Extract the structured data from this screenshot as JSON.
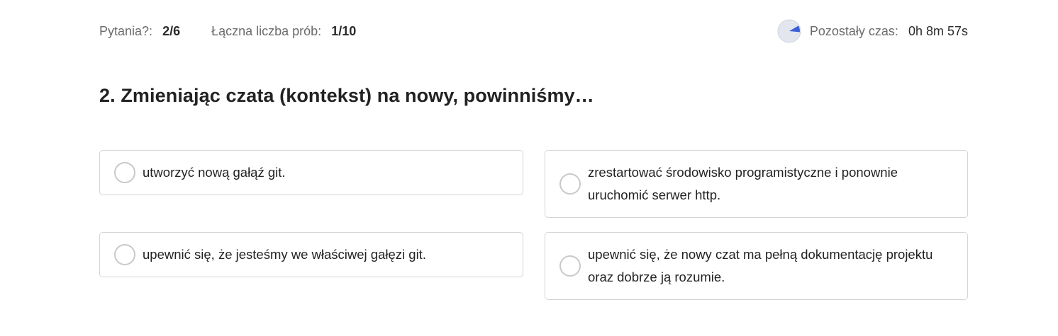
{
  "header": {
    "questions_label": "Pytania?:",
    "questions_value": "2/6",
    "attempts_label": "Łączna liczba prób:",
    "attempts_value": "1/10",
    "timer_icon": "pie-timer-icon",
    "time_label": "Pozostały czas:",
    "time_value": "0h 8m 57s",
    "timer_elapsed_fraction": 0.1
  },
  "question": {
    "title": "2. Zmieniając czata (kontekst) na nowy, powinniśmy…"
  },
  "answers": [
    {
      "text": "utworzyć nową gałąź git.",
      "selected": false
    },
    {
      "text": "zrestartować środowisko programistyczne i ponownie uruchomić serwer http.",
      "selected": false
    },
    {
      "text": "upewnić się, że jesteśmy we właściwej gałęzi git.",
      "selected": false
    },
    {
      "text": "upewnić się, że nowy czat ma pełną dokumentację projektu oraz dobrze ją rozumie.",
      "selected": false
    }
  ],
  "colors": {
    "accent": "#3b5fd9",
    "timer_bg": "#e3e6ee",
    "border": "#d4d4d4"
  }
}
